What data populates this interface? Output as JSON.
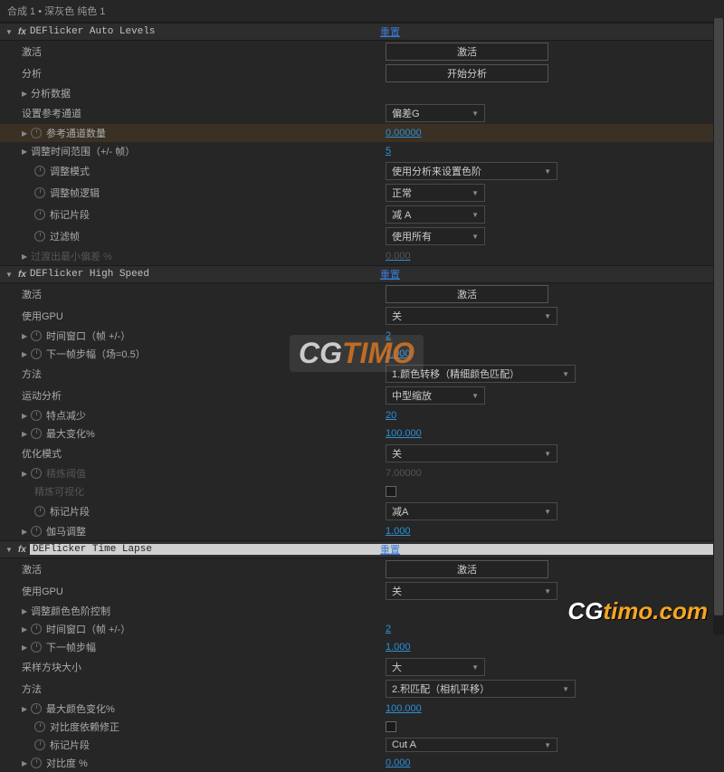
{
  "breadcrumb": "合成 1 • 深灰色 纯色 1",
  "sections": {
    "autolevels": {
      "title": "DEFlicker Auto Levels",
      "reset": "重置",
      "rows": {
        "activate_label": "激活",
        "activate_btn": "激活",
        "analyze_label": "分析",
        "analyze_btn": "开始分析",
        "analyze_data": "分析数据",
        "set_ref_channel": "设置参考通道",
        "set_ref_channel_val": "偏差G",
        "ref_channel_count": "参考通道数量",
        "ref_channel_count_val": "0.00000",
        "adjust_time_range": "调整时间范围（+/- 帧）",
        "adjust_time_range_val": "5",
        "adjust_mode": "调整模式",
        "adjust_mode_val": "使用分析来设置色阶",
        "adjust_frame_logic": "调整帧逻辑",
        "adjust_frame_logic_val": "正常",
        "mark_segment": "标记片段",
        "mark_segment_val": "减 A",
        "filter": "过滤帧",
        "filter_val": "使用所有",
        "fade_min_edge": "过渡出最小偏差 %"
      }
    },
    "highspeed": {
      "title": "DEFlicker High Speed",
      "reset": "重置",
      "rows": {
        "activate_label": "激活",
        "activate_btn": "激活",
        "use_gpu": "使用GPU",
        "use_gpu_val": "关",
        "time_window": "时间窗口（帧 +/-）",
        "time_window_val": "2",
        "next_step": "下一帧步幅（场=0.5）",
        "next_step_val": "1.000",
        "method": "方法",
        "method_val": "1.颜色转移（精细颜色匹配）",
        "motion_analysis": "运动分析",
        "motion_analysis_val": "中型缩放",
        "feature_reduce": "特点减少",
        "feature_reduce_val": "20",
        "max_change": "最大变化%",
        "max_change_val": "100.000",
        "optimize_mode": "优化模式",
        "optimize_mode_val": "关",
        "refine_threshold": "精炼阈值",
        "refine_threshold_val": "7.00000",
        "refine_visible": "精炼可视化",
        "mark_segment": "标记片段",
        "mark_segment_val": "减A",
        "gamma_adjust": "伽马调整",
        "gamma_adjust_val": "1.000"
      }
    },
    "timelapse": {
      "title": "DEFlicker Time Lapse",
      "reset": "重置",
      "rows": {
        "activate_label": "激活",
        "activate_btn": "激活",
        "use_gpu": "使用GPU",
        "use_gpu_val": "关",
        "color_levels_control": "调整颜色色阶控制",
        "time_window": "时间窗口（帧 +/-）",
        "time_window_val": "2",
        "next_step": "下一帧步幅",
        "next_step_val": "1.000",
        "sample_block_size": "采样方块大小",
        "sample_block_size_val": "大",
        "method": "方法",
        "method_val": "2.积匹配（相机平移）",
        "max_color_change": "最大颜色变化%",
        "max_color_change_val": "100.000",
        "contrast_dep_fix": "对比度依赖修正",
        "mark_segment": "标记片段",
        "mark_segment_val": "Cut A",
        "contrast_pct": "对比度 %",
        "contrast_pct_val": "0.000"
      }
    }
  },
  "watermark1": "CGTIMO",
  "watermark2": "CGtimo.com"
}
